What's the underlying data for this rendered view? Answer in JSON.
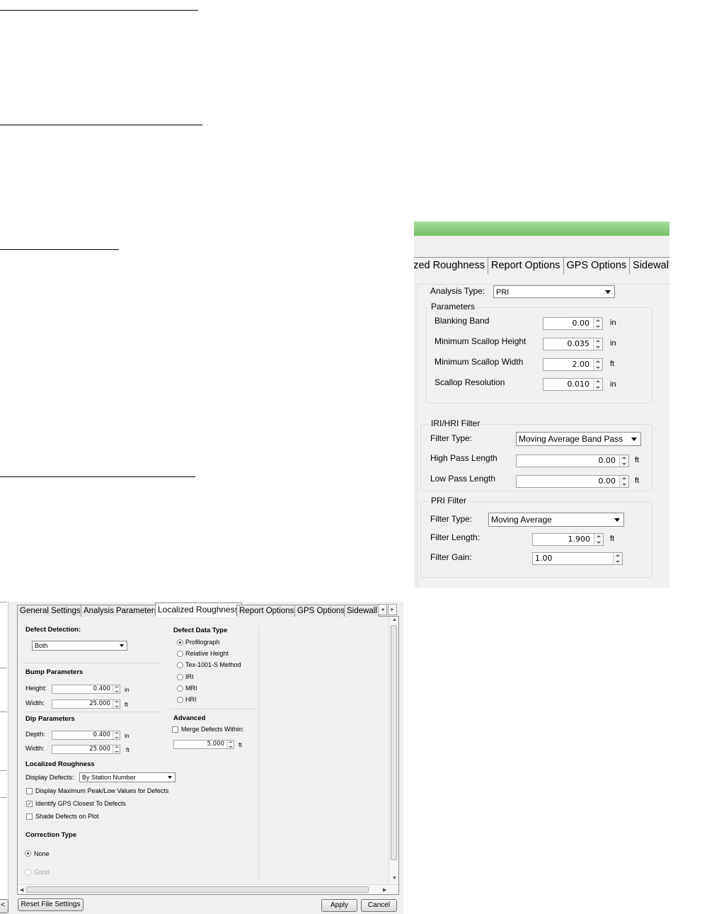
{
  "top_dialog": {
    "tabs": [
      "ized Roughness",
      "Report Options",
      "GPS Options",
      "Sidewalk"
    ],
    "analysis_type_label": "Analysis Type:",
    "analysis_type_value": "PRI",
    "parameters": {
      "legend": "Parameters",
      "rows": [
        {
          "label": "Blanking Band",
          "value": "0.00",
          "unit": "in"
        },
        {
          "label": "Minimum Scallop Height",
          "value": "0.035",
          "unit": "in"
        },
        {
          "label": "Minimum Scallop Width",
          "value": "2.00",
          "unit": "ft"
        },
        {
          "label": "Scallop Resolution",
          "value": "0.010",
          "unit": "in"
        }
      ]
    },
    "iri_filter": {
      "legend": "IRI/HRI Filter",
      "filter_type_label": "Filter Type:",
      "filter_type_value": "Moving Average Band Pass",
      "high_pass_label": "High Pass Length",
      "high_pass_value": "0.00",
      "high_pass_unit": "ft",
      "low_pass_label": "Low Pass Length",
      "low_pass_value": "0.00",
      "low_pass_unit": "ft"
    },
    "pri_filter": {
      "legend": "PRI Filter",
      "filter_type_label": "Filter Type:",
      "filter_type_value": "Moving Average",
      "filter_length_label": "Filter Length:",
      "filter_length_value": "1.900",
      "filter_length_unit": "ft",
      "filter_gain_label": "Filter Gain:",
      "filter_gain_value": "1.00"
    }
  },
  "bottom_dialog": {
    "tabs": [
      "General Settings",
      "Analysis Parameters",
      "Localized Roughness",
      "Report Options",
      "GPS Options",
      "Sidewall"
    ],
    "active_tab": "Localized Roughness",
    "defect_detection": {
      "label": "Defect Detection:",
      "value": "Both"
    },
    "bump": {
      "heading": "Bump Parameters",
      "height_label": "Height:",
      "height_value": "0.400",
      "height_unit": "in",
      "width_label": "Width:",
      "width_value": "25.000",
      "width_unit": "ft"
    },
    "dip": {
      "heading": "Dip Parameters",
      "depth_label": "Depth:",
      "depth_value": "0.400",
      "depth_unit": "in",
      "width_label": "Width:",
      "width_value": "25.000",
      "width_unit": "ft"
    },
    "defect_data_type": {
      "heading": "Defect Data Type",
      "options": [
        "Profilograph",
        "Relative Height",
        "Tex-1001-S Method",
        "IRI",
        "MRI",
        "HRI"
      ],
      "selected": "Profilograph"
    },
    "advanced": {
      "heading": "Advanced",
      "merge_label": "Merge Defects Within:",
      "merge_checked": false,
      "merge_value": "5.000",
      "merge_unit": "ft"
    },
    "localized_roughness": {
      "heading": "Localized Roughness",
      "display_defects_label": "Display Defects:",
      "display_defects_value": "By Station Number",
      "checkboxes": [
        {
          "label": "Display Maximum Peak/Low Values for Defects",
          "checked": false
        },
        {
          "label": "Identify GPS Closest To Defects",
          "checked": true
        },
        {
          "label": "Shade Defects on Plot",
          "checked": false
        }
      ]
    },
    "correction_type": {
      "heading": "Correction Type",
      "options": [
        {
          "label": "None",
          "checked": true,
          "enabled": true
        },
        {
          "label": "Grind",
          "checked": false,
          "enabled": false
        }
      ]
    },
    "buttons": {
      "reset": "Reset File Settings",
      "apply": "Apply",
      "cancel": "Cancel"
    },
    "left_strip_button": "<"
  },
  "colors": {
    "title_bar": "#79c06b",
    "dialog_bg": "#f0f0f0",
    "group_border": "#d5dfe5"
  }
}
